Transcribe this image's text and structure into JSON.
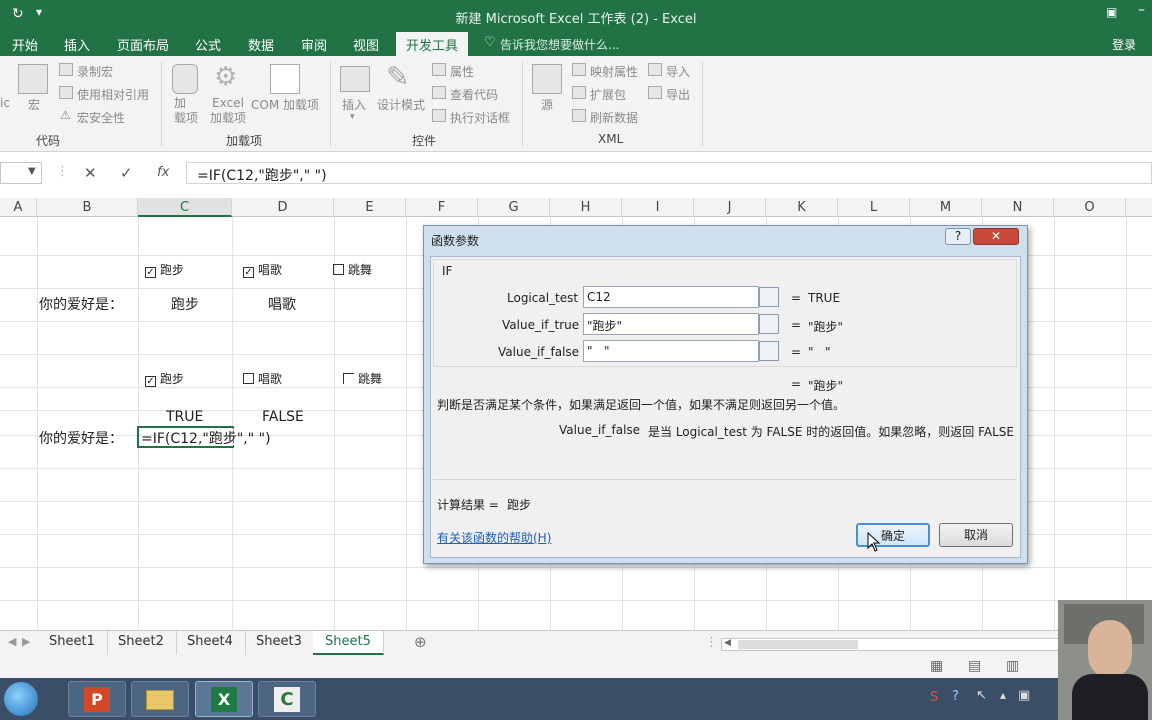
{
  "window": {
    "title": "新建 Microsoft Excel 工作表 (2) - Excel"
  },
  "tabs": [
    "开始",
    "插入",
    "页面布局",
    "公式",
    "数据",
    "审阅",
    "视图",
    "开发工具"
  ],
  "active_tab": "开发工具",
  "tell_me": "告诉我您想要做什么...",
  "login": "登录",
  "ribbon": {
    "code_group": {
      "label": "代码",
      "left_frag": "ic",
      "macro": "宏",
      "record": "录制宏",
      "relative": "使用相对引用",
      "security": "宏安全性"
    },
    "addins_group": {
      "label": "加载项",
      "addins": "加\n载项",
      "excel_addins": "Excel\n加载项",
      "com_addins": "COM 加载项"
    },
    "controls_group": {
      "label": "控件",
      "insert": "插入",
      "design": "设计模式",
      "properties": "属性",
      "view_code": "查看代码",
      "run_dialog": "执行对话框"
    },
    "xml_group": {
      "label": "XML",
      "source": "源",
      "map_props": "映射属性",
      "expansion": "扩展包",
      "refresh": "刷新数据",
      "import": "导入",
      "export": "导出"
    }
  },
  "formula_bar": {
    "formula": "=IF(C12,\"跑步\",\"   \")",
    "fx": "fx"
  },
  "columns": [
    "A",
    "B",
    "C",
    "D",
    "E",
    "F",
    "G",
    "H",
    "I",
    "J",
    "K",
    "L",
    "M",
    "N",
    "O"
  ],
  "selected_column": "C",
  "cells": {
    "row1_checks": [
      "跑步",
      "唱歌",
      "跳舞"
    ],
    "row1_checked": [
      true,
      true,
      false
    ],
    "label1": "你的爱好是：",
    "row2_vals": [
      "跑步",
      "唱歌"
    ],
    "row3_checks": [
      "跑步",
      "唱歌",
      "跳舞"
    ],
    "row3_checked": [
      true,
      false,
      false
    ],
    "true_false": [
      "TRUE",
      "FALSE"
    ],
    "label2": "你的爱好是：",
    "editing": "=IF(C12,\"跑步\",\"   \")"
  },
  "dialog": {
    "title": "函数参数",
    "func": "IF",
    "args": [
      {
        "name": "Logical_test",
        "value": "C12",
        "result": "TRUE"
      },
      {
        "name": "Value_if_true",
        "value": "\"跑步\"",
        "result": "\"跑步\""
      },
      {
        "name": "Value_if_false",
        "value": "\"   \"",
        "result": "\"   \""
      }
    ],
    "eq": "=",
    "overall_result": "\"跑步\"",
    "description": "判断是否满足某个条件，如果满足返回一个值，如果不满足则返回另一个值。",
    "arg_desc_name": "Value_if_false",
    "arg_desc": "是当 Logical_test 为 FALSE 时的返回值。如果忽略，则返回 FALSE",
    "calc_label": "计算结果 =",
    "calc_value": "跑步",
    "help_link": "有关该函数的帮助(H)",
    "ok": "确定",
    "cancel": "取消",
    "help_btn": "?"
  },
  "sheets": [
    "Sheet1",
    "Sheet2",
    "Sheet4",
    "Sheet3",
    "Sheet5"
  ],
  "active_sheet": "Sheet5",
  "colors": {
    "excel_green": "#217346",
    "dialog_frame": "#cfdff0",
    "link": "#1f5fbf"
  }
}
